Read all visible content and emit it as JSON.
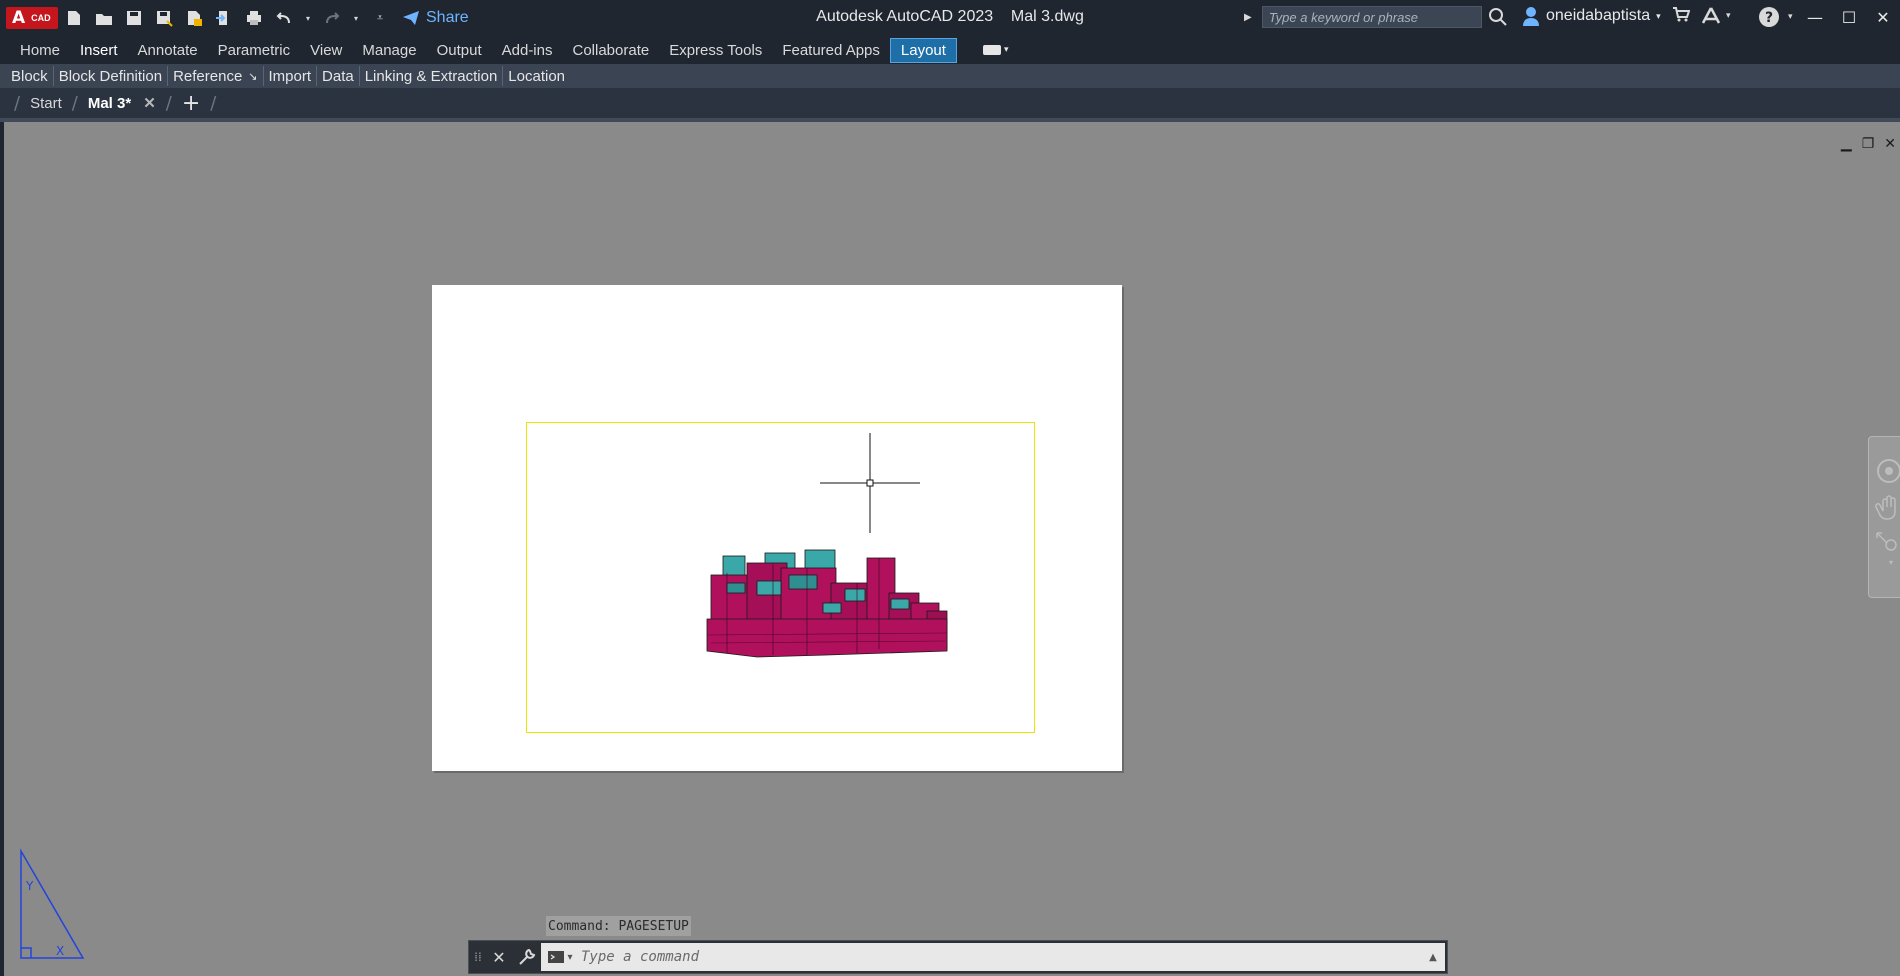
{
  "app": {
    "logo_label": "CAD",
    "title": "Autodesk AutoCAD 2023    Mal 3.dwg",
    "share_label": "Share"
  },
  "search": {
    "placeholder": "Type a keyword or phrase"
  },
  "user": {
    "name": "oneidabaptista"
  },
  "ribbon": {
    "tabs": [
      {
        "label": "Home"
      },
      {
        "label": "Insert"
      },
      {
        "label": "Annotate"
      },
      {
        "label": "Parametric"
      },
      {
        "label": "View"
      },
      {
        "label": "Manage"
      },
      {
        "label": "Output"
      },
      {
        "label": "Add-ins"
      },
      {
        "label": "Collaborate"
      },
      {
        "label": "Express Tools"
      },
      {
        "label": "Featured Apps"
      },
      {
        "label": "Layout"
      }
    ],
    "active_tab": "Insert",
    "highlighted_tab": "Layout",
    "panels": [
      {
        "label": "Block"
      },
      {
        "label": "Block Definition"
      },
      {
        "label": "Reference"
      },
      {
        "label": "Import"
      },
      {
        "label": "Data"
      },
      {
        "label": "Linking & Extraction"
      },
      {
        "label": "Location"
      }
    ]
  },
  "doc_tabs": {
    "start_label": "Start",
    "active_label": "Mal 3*",
    "new_tab_symbol": "+"
  },
  "command": {
    "history": "Command: PAGESETUP",
    "placeholder": "Type a command"
  },
  "colors": {
    "chrome_dark": "#1f2630",
    "ribbon_panels": "#3b4453",
    "accent_blue": "#1e6fa8",
    "viewport_border": "#e6e600",
    "model_magenta": "#b0105c",
    "model_teal": "#3aa7a8",
    "ucs_blue": "#2244dd"
  }
}
